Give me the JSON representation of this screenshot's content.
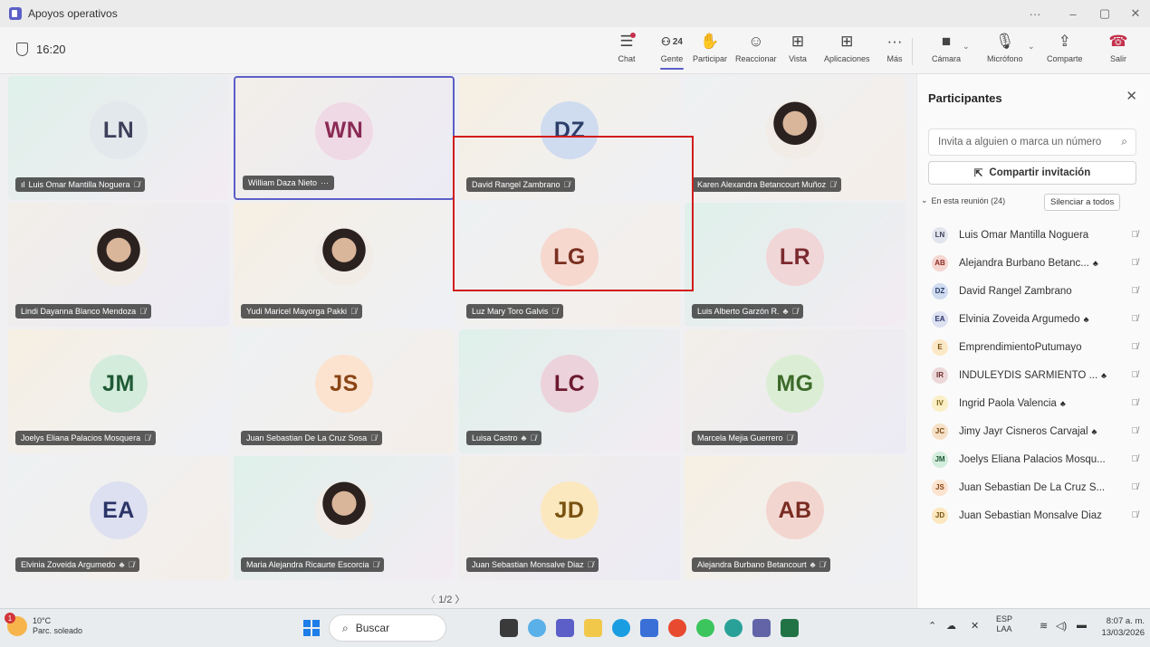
{
  "window": {
    "title": "Apoyos operativos"
  },
  "meeting": {
    "time": "16:20"
  },
  "toolbar": {
    "chat": "Chat",
    "people": "Gente",
    "people_count": "24",
    "raise": "Participar",
    "react": "Reaccionar",
    "view": "Vista",
    "apps": "Aplicaciones",
    "more": "Más",
    "camera": "Cámara",
    "mic": "Micrófono",
    "share": "Comparte",
    "leave": "Salir"
  },
  "tiles": [
    {
      "name": "Luis Omar Mantilla Noguera",
      "initials": "LN",
      "bg": "#e3e8ed",
      "fg": "#3f3f5a",
      "signal": true
    },
    {
      "name": "William Daza Nieto",
      "initials": "WN",
      "bg": "#efd9e4",
      "fg": "#8a2a55",
      "more": "···"
    },
    {
      "name": "David Rangel Zambrano",
      "initials": "DZ",
      "bg": "#cfdbef",
      "fg": "#2c3e6a"
    },
    {
      "name": "Karen Alexandra Betancourt Muñoz",
      "photo": true
    },
    {
      "name": "Lindi Dayanna Blanco Mendoza",
      "photo": true
    },
    {
      "name": "Yudi Maricel Mayorga Pakki",
      "photo": true
    },
    {
      "name": "Luz Mary Toro Galvis",
      "initials": "LG",
      "bg": "#f6d8cf",
      "fg": "#7a2f20"
    },
    {
      "name": "Luis Alberto Garzón R.",
      "initials": "LR",
      "bg": "#f1d6d7",
      "fg": "#7b2a2f",
      "guest": true
    },
    {
      "name": "Joelys Eliana Palacios Mosquera",
      "initials": "JM",
      "bg": "#d4ecdc",
      "fg": "#1f5a35"
    },
    {
      "name": "Juan Sebastian De La Cruz Sosa",
      "initials": "JS",
      "bg": "#fbe3cf",
      "fg": "#8a4515"
    },
    {
      "name": "Luisa Castro",
      "initials": "LC",
      "bg": "#ecd2da",
      "fg": "#6c1a30",
      "guest": true
    },
    {
      "name": "Marcela Mejia Guerrero",
      "initials": "MG",
      "bg": "#dbeed5",
      "fg": "#3c6a2a"
    },
    {
      "name": "Elvinia Zoveida Argumedo",
      "initials": "EA",
      "bg": "#dde0f0",
      "fg": "#2b3568",
      "guest": true
    },
    {
      "name": "Maria Alejandra Ricaurte Escorcia",
      "photo": true
    },
    {
      "name": "Juan Sebastian Monsalve Diaz",
      "initials": "JD",
      "bg": "#fbe8bf",
      "fg": "#7a5210"
    },
    {
      "name": "Alejandra Burbano Betancourt",
      "initials": "AB",
      "bg": "#f3d5d0",
      "fg": "#7a2c22",
      "guest": true
    }
  ],
  "pager": "1/2",
  "panel": {
    "title": "Participantes",
    "invite_placeholder": "Invita a alguien o marca un número",
    "share_invite": "Compartir invitación",
    "section": "En esta reunión (24)",
    "mute_all": "Silenciar a todos",
    "people": [
      {
        "initials": "LN",
        "name": "Luis Omar Mantilla Noguera",
        "bg": "#e3e5ee",
        "fg": "#3f3f5a"
      },
      {
        "initials": "AB",
        "name": "Alejandra Burbano Betanc...",
        "bg": "#f6d6d1",
        "fg": "#8a2c22",
        "guest": true
      },
      {
        "initials": "DZ",
        "name": "David Rangel Zambrano",
        "bg": "#cfdbef",
        "fg": "#2c3e6a"
      },
      {
        "initials": "EA",
        "name": "Elvinia Zoveida Argumedo",
        "bg": "#dde0f0",
        "fg": "#2b3568",
        "guest": true
      },
      {
        "initials": "E",
        "name": "EmprendimientoPutumayo",
        "bg": "#fbe8c6",
        "fg": "#7a5210"
      },
      {
        "initials": "IR",
        "name": "INDULEYDIS SARMIENTO ...",
        "bg": "#ecd8d8",
        "fg": "#6a2b2b",
        "guest": true
      },
      {
        "initials": "IV",
        "name": "Ingrid Paola Valencia",
        "bg": "#fbefc7",
        "fg": "#7a6010",
        "guest": true
      },
      {
        "initials": "JC",
        "name": "Jimy Jayr Cisneros Carvajal",
        "bg": "#f6e1c8",
        "fg": "#7a4a10",
        "guest": true
      },
      {
        "initials": "JM",
        "name": "Joelys Eliana Palacios Mosqu...",
        "bg": "#d4ecdc",
        "fg": "#1f5a35"
      },
      {
        "initials": "JS",
        "name": "Juan Sebastian De La Cruz S...",
        "bg": "#fbe3cf",
        "fg": "#8a4515"
      },
      {
        "initials": "JD",
        "name": "Juan Sebastian Monsalve Diaz",
        "bg": "#fbe8bf",
        "fg": "#7a5210"
      }
    ]
  },
  "taskbar": {
    "temp": "10°C",
    "weather": "Parc. soleado",
    "badge": "1",
    "search": "Buscar",
    "lang1": "ESP",
    "lang2": "LAA",
    "time": "8:07 a. m.",
    "date": "13/03/2026"
  }
}
